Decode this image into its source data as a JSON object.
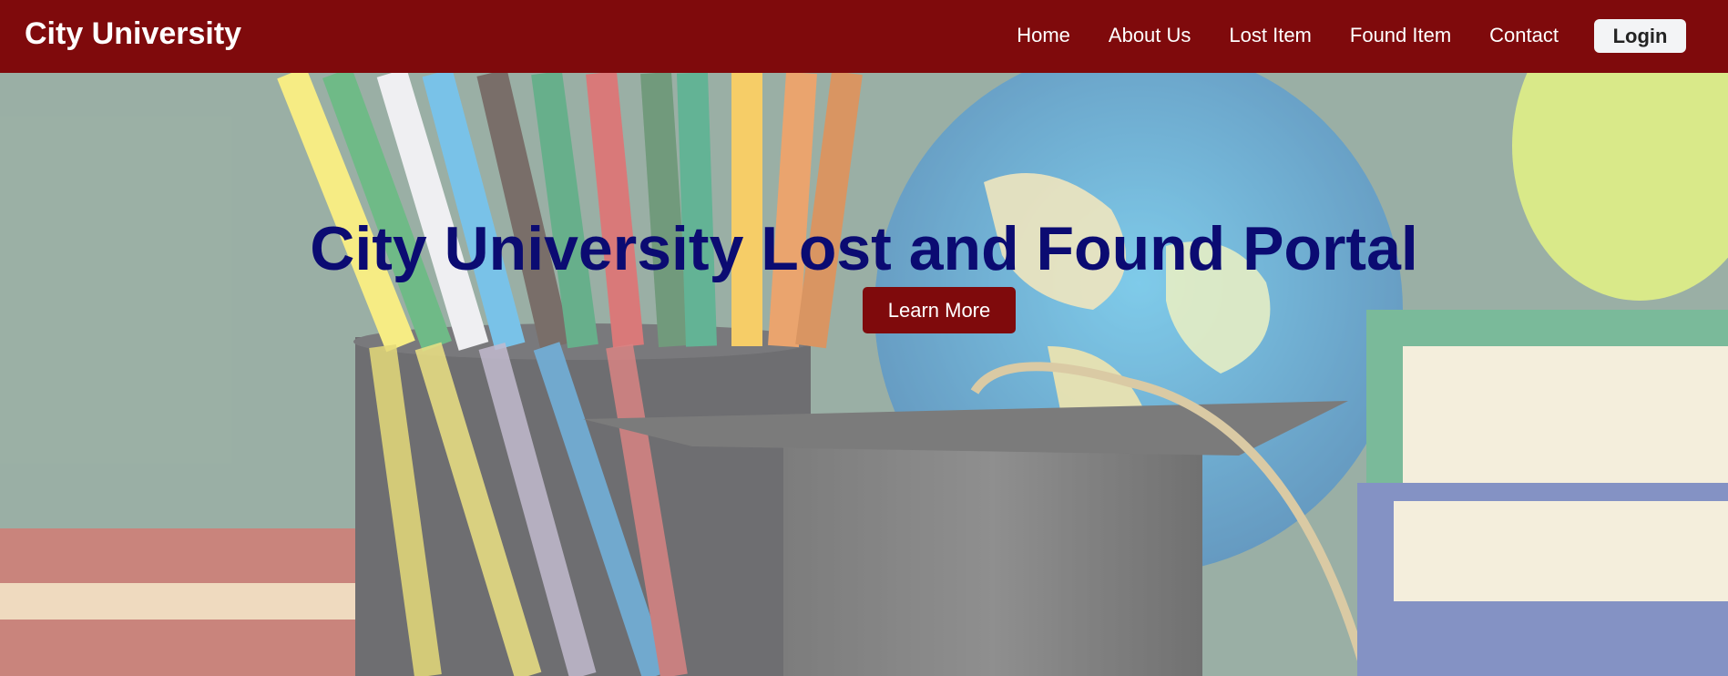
{
  "navbar": {
    "brand": "City University",
    "links": [
      "Home",
      "About Us",
      "Lost Item",
      "Found Item",
      "Contact"
    ],
    "login_label": "Login",
    "background_color": "#7f0a0c"
  },
  "hero": {
    "title": "City University Lost and Found Portal",
    "cta_label": "Learn More",
    "title_color": "#0b0b72",
    "background_image": "school-supplies-photo"
  }
}
